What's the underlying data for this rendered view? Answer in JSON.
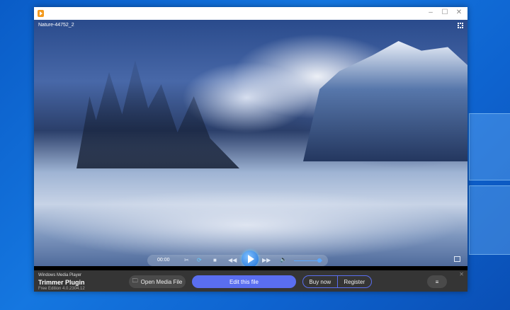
{
  "window": {
    "minimize": "–",
    "maximize": "☐",
    "close": "✕"
  },
  "video": {
    "title": "Nature-44752_2",
    "time": "00:00",
    "volume_fraction": 0.8
  },
  "controls": {
    "trim": "✂",
    "loop": "⟳",
    "stop": "■",
    "rewind": "◀◀",
    "forward": "▶▶",
    "volume": "🔈"
  },
  "panel": {
    "product_line": "Windows Media Player",
    "product_name": "Trimmer Plugin",
    "edition": "Free Edition 4.0.2304.12",
    "open_label": "Open Media File",
    "edit_label": "Edit this file",
    "buy_label": "Buy now",
    "register_label": "Register",
    "menu": "≡",
    "close": "✕"
  },
  "colors": {
    "accent": "#5a6ef0",
    "panel": "#353535"
  }
}
